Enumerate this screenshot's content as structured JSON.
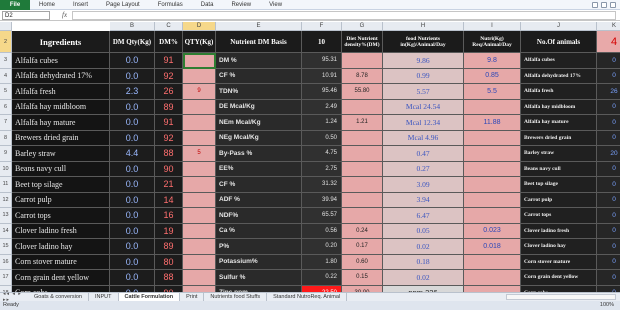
{
  "ribbon": {
    "file": "File",
    "tabs": [
      "Home",
      "Insert",
      "Page Layout",
      "Formulas",
      "Data",
      "Review",
      "View"
    ]
  },
  "formula_bar": {
    "name_box": "D2",
    "fx": "fx",
    "value": ""
  },
  "columns": [
    "B",
    "C",
    "D",
    "E",
    "F",
    "G",
    "H",
    "I",
    "J",
    "K"
  ],
  "rows": [
    "2",
    "3",
    "4",
    "5",
    "6",
    "7",
    "8",
    "9",
    "10",
    "11",
    "12",
    "13",
    "14",
    "15",
    "16",
    "17",
    "18"
  ],
  "header": {
    "ingredients": "Ingredients",
    "dm_qty": "DM Qty(Kg)",
    "dm_pct": "DM%",
    "qty": "QTY(Kg)",
    "nutrient": "Nutrient DM Basis",
    "ten": "10",
    "diet": "Diet Nutrient density%(DM)",
    "food": "food Nutrients in(Kg)/Animal/Day",
    "nutrreq": "Nutri(Kg) Req/Animal/Day",
    "animals": "No.Of animals",
    "animals_count": "4"
  },
  "data_rows": [
    {
      "ing": "Alfalfa cubes",
      "dm": "0.0",
      "pct": "91",
      "qty": "",
      "nut": "DM %",
      "val": "95.31",
      "diet": "",
      "food": "9.86",
      "req": "9.8",
      "name": "Alfalfa cubes",
      "num": "0"
    },
    {
      "ing": "Alfalfa dehydrated 17%",
      "dm": "0.0",
      "pct": "92",
      "qty": "",
      "nut": "CF %",
      "val": "10.91",
      "diet": "8.78",
      "food": "0.99",
      "req": "0.85",
      "name": "Alfalfa dehydrated 17%",
      "num": "0"
    },
    {
      "ing": "Alfalfa fresh",
      "dm": "2.3",
      "pct": "26",
      "qty": "9",
      "nut": "TDN%",
      "val": "95.46",
      "diet": "55.80",
      "food": "5.57",
      "req": "5.5",
      "name": "Alfalfa fresh",
      "num": "26"
    },
    {
      "ing": "Alfalfa hay midbloom",
      "dm": "0.0",
      "pct": "89",
      "qty": "",
      "nut": "DE Mcal/Kg",
      "val": "2.49",
      "diet": "",
      "food": "Mcal  24.54",
      "req": "",
      "name": "Alfalfa hay midbloom",
      "num": "0"
    },
    {
      "ing": "Alfalfa hay mature",
      "dm": "0.0",
      "pct": "91",
      "qty": "",
      "nut": "NEm Mcal/Kg",
      "val": "1.24",
      "diet": "1.21",
      "food": "Mcal  12.34",
      "req": "11.88",
      "name": "Alfalfa hay mature",
      "num": "0"
    },
    {
      "ing": "Brewers dried grain",
      "dm": "0.0",
      "pct": "92",
      "qty": "",
      "nut": "NEg Mcal/Kg",
      "val": "0.50",
      "diet": "",
      "food": "Mcal  4.96",
      "req": "",
      "name": "Brewers dried grain",
      "num": "0"
    },
    {
      "ing": "Barley straw",
      "dm": "4.4",
      "pct": "88",
      "qty": "5",
      "nut": "By-Pass %",
      "val": "4.75",
      "diet": "",
      "food": "0.47",
      "req": "",
      "name": "Barley straw",
      "num": "20"
    },
    {
      "ing": "Beans navy cull",
      "dm": "0.0",
      "pct": "90",
      "qty": "",
      "nut": "EE%",
      "val": "2.75",
      "diet": "",
      "food": "0.27",
      "req": "",
      "name": "Beans navy cull",
      "num": "0"
    },
    {
      "ing": "Beet top silage",
      "dm": "0.0",
      "pct": "21",
      "qty": "",
      "nut": "CF %",
      "val": "31.32",
      "diet": "",
      "food": "3.09",
      "req": "",
      "name": "Beet top silage",
      "num": "0"
    },
    {
      "ing": "Carrot pulp",
      "dm": "0.0",
      "pct": "14",
      "qty": "",
      "nut": "ADF %",
      "val": "39.94",
      "diet": "",
      "food": "3.94",
      "req": "",
      "name": "Carrot pulp",
      "num": "0"
    },
    {
      "ing": "Carrot tops",
      "dm": "0.0",
      "pct": "16",
      "qty": "",
      "nut": "NDF%",
      "val": "65.57",
      "diet": "",
      "food": "6.47",
      "req": "",
      "name": "Carrot tops",
      "num": "0"
    },
    {
      "ing": "Clover ladino fresh",
      "dm": "0.0",
      "pct": "19",
      "qty": "",
      "nut": "Ca %",
      "val": "0.56",
      "diet": "0.24",
      "food": "0.05",
      "req": "0.023",
      "name": "Clover ladino fresh",
      "num": "0"
    },
    {
      "ing": "Clover ladino hay",
      "dm": "0.0",
      "pct": "89",
      "qty": "",
      "nut": "P%",
      "val": "0.20",
      "diet": "0.17",
      "food": "0.02",
      "req": "0.018",
      "name": "Clover ladino hay",
      "num": "0"
    },
    {
      "ing": "Corn stover mature",
      "dm": "0.0",
      "pct": "80",
      "qty": "",
      "nut": "Potassium%",
      "val": "1.80",
      "diet": "0.60",
      "food": "0.18",
      "req": "",
      "name": "Corn stover mature",
      "num": "0"
    },
    {
      "ing": "Corn grain dent yellow",
      "dm": "0.0",
      "pct": "88",
      "qty": "",
      "nut": "Sulfur %",
      "val": "0.22",
      "diet": "0.15",
      "food": "0.02",
      "req": "",
      "name": "Corn grain dent yellow",
      "num": "0"
    },
    {
      "ing": "Corn cobs",
      "dm": "0.0",
      "pct": "90",
      "qty": "",
      "nut": "Zinc ppm",
      "val": "22.50",
      "diet": "30.00",
      "food": "ppm  226",
      "req": "",
      "name": "Corn cobs",
      "num": "0"
    },
    {
      "ing": "Corn bran",
      "dm": "0.9",
      "pct": "90",
      "qty": "1",
      "nut": "Ash%",
      "val": "6.87",
      "diet": "",
      "food": "0.68",
      "req": "",
      "name": "Corn bran",
      "num": "4"
    }
  ],
  "sheet_tabs": [
    "Goats & conversion",
    "INPUT",
    "Cattle Formulation",
    "Print",
    "Nutrients food Stuffs",
    "Standard NutroReq. Animal"
  ],
  "active_sheet": "Cattle Formulation",
  "status": {
    "ready": "Ready",
    "zoom": "100%"
  },
  "colors": {
    "accent": "#1f7a3a",
    "pink": "#e6a8a8",
    "alert_red": "#ff1a1a"
  }
}
